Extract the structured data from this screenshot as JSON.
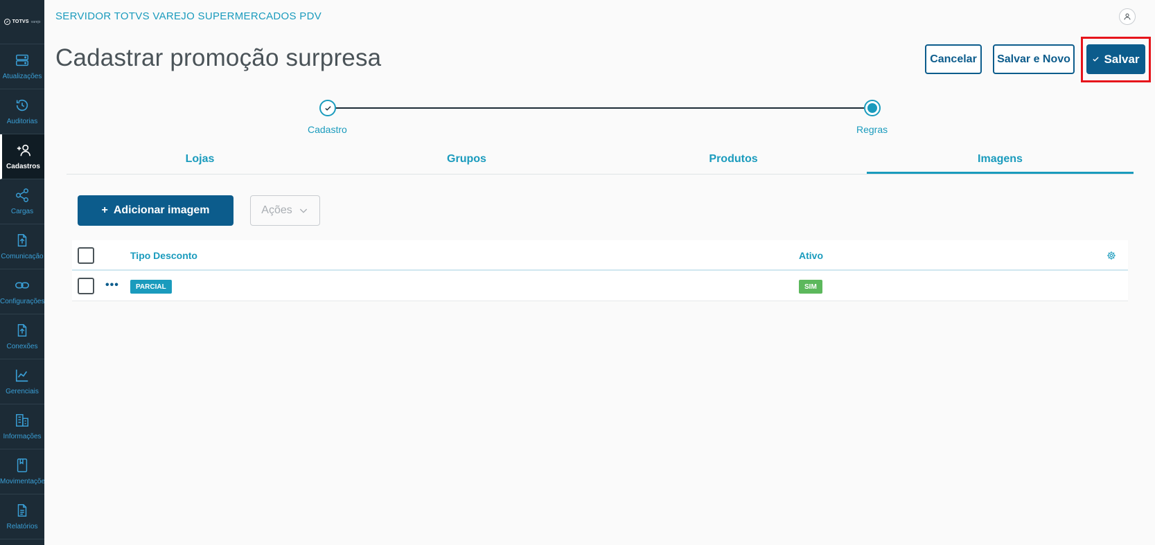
{
  "app_title": "SERVIDOR TOTVS VAREJO SUPERMERCADOS PDV",
  "logo": {
    "text": "TOTVS",
    "sub": "varejo"
  },
  "sidebar": {
    "items": [
      {
        "label": "Atualizações",
        "icon": "server-icon"
      },
      {
        "label": "Auditorias",
        "icon": "history-icon"
      },
      {
        "label": "Cadastros",
        "icon": "add-user-icon",
        "active": true
      },
      {
        "label": "Cargas",
        "icon": "share-icon"
      },
      {
        "label": "Comunicação",
        "icon": "file-upload-icon"
      },
      {
        "label": "Configurações",
        "icon": "link-icon"
      },
      {
        "label": "Conexões",
        "icon": "file-upload-icon"
      },
      {
        "label": "Gerenciais",
        "icon": "chart-icon"
      },
      {
        "label": "Informações",
        "icon": "building-icon"
      },
      {
        "label": "Movimentações",
        "icon": "book-icon"
      },
      {
        "label": "Relatórios",
        "icon": "document-icon"
      }
    ]
  },
  "page_title": "Cadastrar promoção surpresa",
  "buttons": {
    "cancel": "Cancelar",
    "save_new": "Salvar e Novo",
    "save": "Salvar"
  },
  "stepper": {
    "steps": [
      {
        "label": "Cadastro",
        "status": "done"
      },
      {
        "label": "Regras",
        "status": "active"
      }
    ]
  },
  "tabs": [
    {
      "label": "Lojas"
    },
    {
      "label": "Grupos"
    },
    {
      "label": "Produtos"
    },
    {
      "label": "Imagens",
      "active": true
    }
  ],
  "actions": {
    "add_image": "Adicionar imagem",
    "add_prefix": "+",
    "more_actions": "Ações"
  },
  "table": {
    "columns": [
      "Tipo Desconto",
      "Ativo"
    ],
    "rows": [
      {
        "tipo_desconto": "PARCIAL",
        "ativo": "SIM"
      }
    ]
  },
  "colors": {
    "primary": "#0c5c8c",
    "accent": "#1a9bbd",
    "sidebar": "#1c2b36",
    "success": "#5cb85c",
    "highlight": "#e6141b"
  }
}
